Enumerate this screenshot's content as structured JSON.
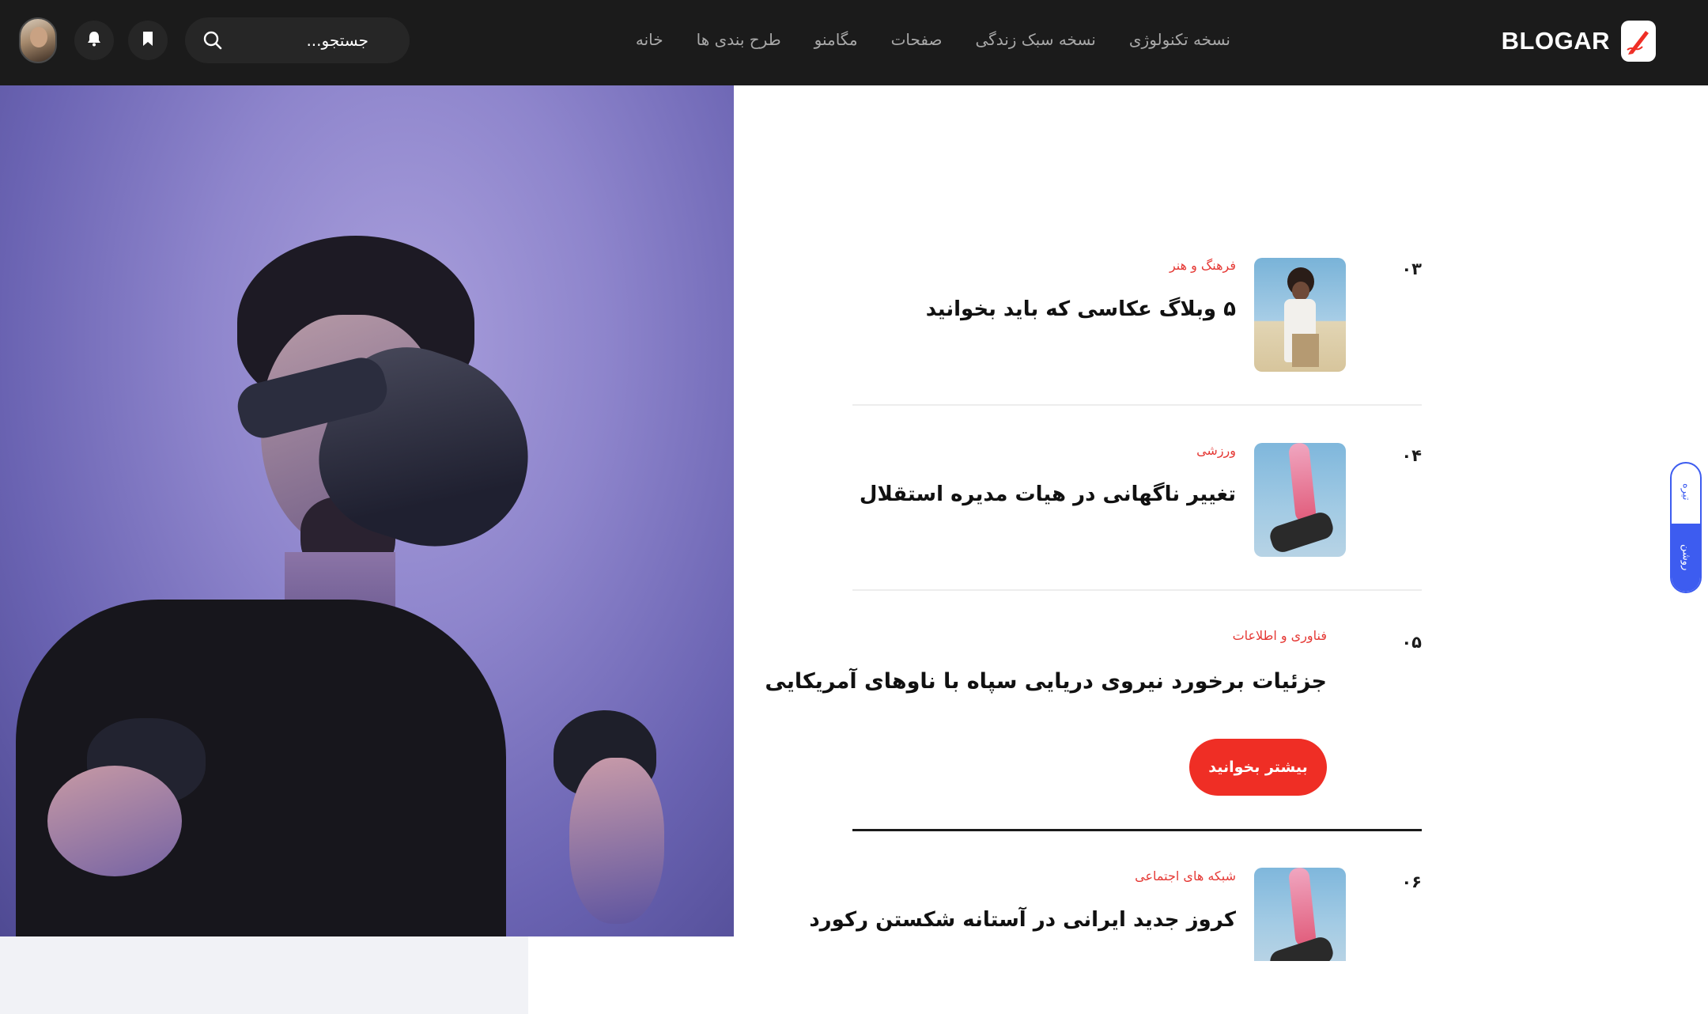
{
  "header": {
    "brand": "BLOGAR",
    "nav": [
      "خانه",
      "طرح بندی ها",
      "مگامنو",
      "صفحات",
      "نسخه سبک زندگی",
      "نسخه تکنولوژی"
    ],
    "search_placeholder": "جستجو...",
    "icons": [
      "search-icon",
      "bookmark-icon",
      "bell-icon"
    ]
  },
  "articles": [
    {
      "num": "۰۳",
      "category": "فرهنگ و هنر",
      "title": "۵ وبلاگ عکاسی که باید بخوانید"
    },
    {
      "num": "۰۴",
      "category": "ورزشی",
      "title": "تغییر ناگهانی در هیات مدیره استقلال"
    },
    {
      "num": "۰۵",
      "category": "فناوری و اطلاعات",
      "title": "جزئیات برخورد نیروی دریایی سپاه با ناوهای آمریکایی",
      "button": "بیشتر بخوانید"
    },
    {
      "num": "۰۶",
      "category": "شبکه های اجتماعی",
      "title": "کروز جدید ایرانی در آستانه شکستن رکورد"
    }
  ],
  "theme_toggle": {
    "dark": "تیره",
    "light": "روشن"
  },
  "colors": {
    "accent": "#ef2e25",
    "topbar": "#1b1b1b",
    "toggle": "#3d5cf0"
  }
}
